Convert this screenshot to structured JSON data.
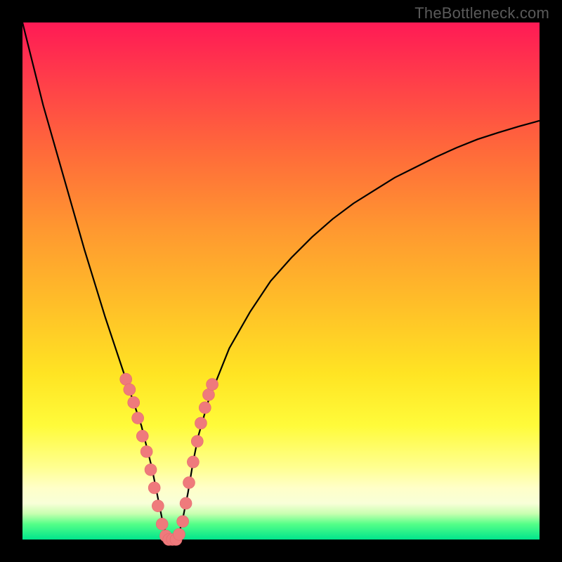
{
  "watermark": "TheBottleneck.com",
  "colors": {
    "frame": "#000000",
    "curve": "#000000",
    "marker_fill": "#ef7a7c",
    "marker_stroke": "#e46a6e"
  },
  "chart_data": {
    "type": "line",
    "title": "",
    "xlabel": "",
    "ylabel": "",
    "xlim": [
      0,
      100
    ],
    "ylim": [
      0,
      100
    ],
    "grid": false,
    "legend": false,
    "x": [
      0,
      2,
      4,
      6,
      8,
      10,
      12,
      14,
      16,
      18,
      20,
      21,
      22,
      23,
      24,
      25,
      26,
      27,
      28,
      29,
      30,
      31,
      32,
      33,
      34,
      36,
      38,
      40,
      44,
      48,
      52,
      56,
      60,
      64,
      68,
      72,
      76,
      80,
      84,
      88,
      92,
      96,
      100
    ],
    "y": [
      100,
      92,
      84,
      77,
      70,
      63,
      56,
      49.5,
      43,
      37,
      31,
      28,
      25,
      22,
      18,
      14,
      9,
      4,
      0,
      0,
      0,
      4,
      9,
      15,
      20,
      27,
      32,
      37,
      44,
      50,
      54.5,
      58.5,
      62,
      65,
      67.5,
      70,
      72,
      74,
      75.8,
      77.4,
      78.7,
      79.9,
      81
    ],
    "markers": {
      "left": [
        {
          "x": 20,
          "y": 31
        },
        {
          "x": 20.7,
          "y": 29
        },
        {
          "x": 21.5,
          "y": 26.5
        },
        {
          "x": 22.3,
          "y": 23.5
        },
        {
          "x": 23.2,
          "y": 20
        },
        {
          "x": 24,
          "y": 17
        },
        {
          "x": 24.8,
          "y": 13.5
        },
        {
          "x": 25.5,
          "y": 10
        },
        {
          "x": 26.2,
          "y": 6.5
        },
        {
          "x": 27,
          "y": 3
        },
        {
          "x": 27.7,
          "y": 0.7
        }
      ],
      "bottom": [
        {
          "x": 28.3,
          "y": 0
        },
        {
          "x": 29,
          "y": 0
        },
        {
          "x": 29.7,
          "y": 0
        }
      ],
      "right": [
        {
          "x": 30.3,
          "y": 1
        },
        {
          "x": 31,
          "y": 3.5
        },
        {
          "x": 31.6,
          "y": 7
        },
        {
          "x": 32.2,
          "y": 11
        },
        {
          "x": 33,
          "y": 15
        },
        {
          "x": 33.8,
          "y": 19
        },
        {
          "x": 34.5,
          "y": 22.5
        },
        {
          "x": 35.3,
          "y": 25.5
        },
        {
          "x": 36,
          "y": 28
        },
        {
          "x": 36.7,
          "y": 30
        }
      ]
    }
  }
}
